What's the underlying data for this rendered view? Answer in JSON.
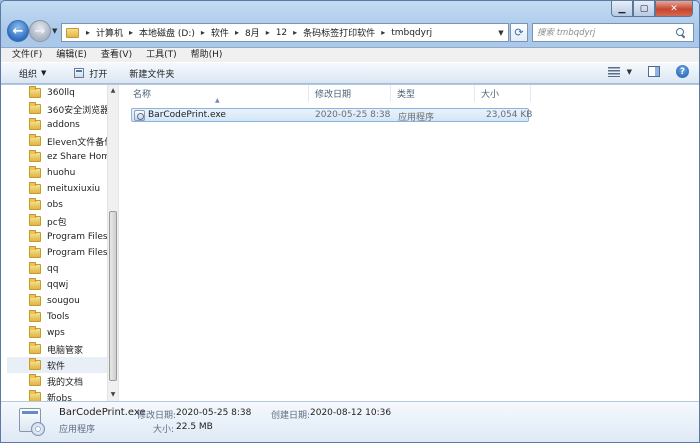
{
  "window": {
    "caption_buttons": {
      "minimize": "▁",
      "maximize": "▢",
      "close": "✕"
    }
  },
  "nav": {
    "back_glyph": "←",
    "forward_glyph": "→",
    "breadcrumbs": [
      "计算机",
      "本地磁盘 (D:)",
      "软件",
      "8月",
      "12",
      "条码标签打印软件",
      "tmbqdyrj"
    ],
    "search_placeholder": "搜索 tmbqdyrj"
  },
  "menu": {
    "items": [
      "文件(F)",
      "编辑(E)",
      "查看(V)",
      "工具(T)",
      "帮助(H)"
    ]
  },
  "toolbar": {
    "organize": "组织",
    "open": "打开",
    "new_folder": "新建文件夹",
    "icons": [
      "view-options-icon",
      "preview-pane-icon",
      "help-icon"
    ]
  },
  "nav_pane": {
    "items": [
      "360llq",
      "360安全浏览器",
      "addons",
      "Eleven文件备份",
      "ez Share Home",
      "huohu",
      "meituxiuxiu",
      "obs",
      "pc包",
      "Program Files",
      "Program Files",
      "qq",
      "qqwj",
      "sougou",
      "Tools",
      "wps",
      "电脑管家",
      "软件",
      "我的文档",
      "新obs"
    ],
    "selected_index": 17
  },
  "file_list": {
    "columns": [
      "名称",
      "修改日期",
      "类型",
      "大小"
    ],
    "rows": [
      {
        "name": "BarCodePrint.exe",
        "modified": "2020-05-25 8:38",
        "type": "应用程序",
        "size": "23,054 KB"
      }
    ]
  },
  "details": {
    "file_name": "BarCodePrint.exe",
    "modified_label": "修改日期:",
    "modified_value": "2020-05-25 8:38",
    "created_label": "创建日期:",
    "created_value": "2020-08-12 10:36",
    "type": "应用程序",
    "size_label": "大小:",
    "size_value": "22.5 MB"
  },
  "colors": {
    "accent": "#2f6fbf",
    "selection": "#d3e6f8",
    "chrome": "#b9d4ef"
  }
}
